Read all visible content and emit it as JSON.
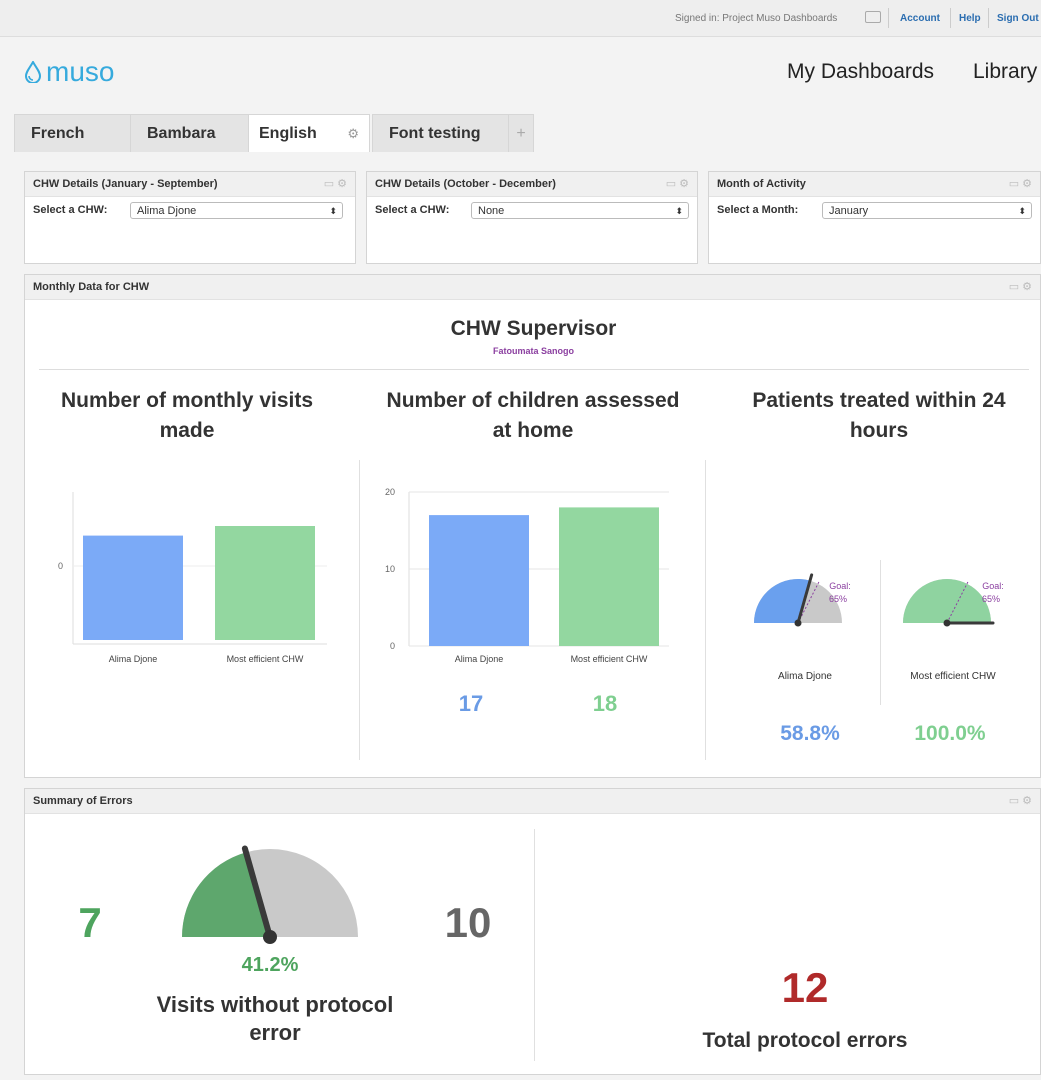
{
  "topbar": {
    "signed_in": "Signed in: Project Muso Dashboards",
    "account": "Account",
    "help": "Help",
    "sign_out": "Sign Out"
  },
  "logo": "muso",
  "nav": {
    "my_dashboards": "My Dashboards",
    "library": "Library"
  },
  "tabs": [
    {
      "label": "French"
    },
    {
      "label": "Bambara"
    },
    {
      "label": "English"
    },
    {
      "label": "Font testing"
    },
    {
      "label": "+"
    }
  ],
  "filters": [
    {
      "title": "CHW Details (January - September)",
      "label": "Select a CHW:",
      "value": "Alima Djone"
    },
    {
      "title": "CHW Details (October - December)",
      "label": "Select a CHW:",
      "value": "None"
    },
    {
      "title": "Month of Activity",
      "label": "Select a Month:",
      "value": "January"
    }
  ],
  "monthly": {
    "panel_title": "Monthly Data for CHW",
    "heading": "CHW Supervisor",
    "subheading": "Fatoumata Sanogo",
    "col1_title": "Number of monthly visits made",
    "col2_title": "Number of children assessed at home",
    "col3_title": "Patients treated within 24 hours",
    "col2_value1": "17",
    "col2_value2": "18",
    "col3_value1": "58.8%",
    "col3_value2": "100.0%",
    "goal_text": "Goal:",
    "goal_pct": "65%",
    "gauge1_label": "Alima Djone",
    "gauge2_label": "Most efficient CHW"
  },
  "chart_data": [
    {
      "type": "bar",
      "title": "Number of monthly visits made",
      "categories": [
        "Alima Djone",
        "Most efficient CHW"
      ],
      "values": [
        0.87,
        0.95
      ],
      "yticks": [
        "0"
      ],
      "colors": [
        "#7baaf7",
        "#93d7a0"
      ]
    },
    {
      "type": "bar",
      "title": "Number of children assessed at home",
      "categories": [
        "Alima Djone",
        "Most efficient CHW"
      ],
      "values": [
        17,
        18
      ],
      "ylim": [
        0,
        20
      ],
      "yticks": [
        "0",
        "10",
        "20"
      ],
      "colors": [
        "#7baaf7",
        "#93d7a0"
      ]
    }
  ],
  "gauges": [
    {
      "value": 0.588,
      "goal": 0.65,
      "color": "#6aa0ee"
    },
    {
      "value": 1.0,
      "goal": 0.65,
      "color": "#8fd3a0"
    },
    {
      "value": 0.412,
      "color": "#5ea76d"
    }
  ],
  "errors": {
    "panel_title": "Summary of Errors",
    "left_value": "7",
    "right_value": "10",
    "percent": "41.2%",
    "gauge_label": "Visits without protocol error",
    "total_value": "12",
    "total_label": "Total protocol errors"
  },
  "colors": {
    "blue_text": "#6a9be5",
    "green_text": "#7fcf90",
    "dark_green": "#4ea45e",
    "red": "#b02a2a",
    "purple": "#8b3fa0"
  }
}
